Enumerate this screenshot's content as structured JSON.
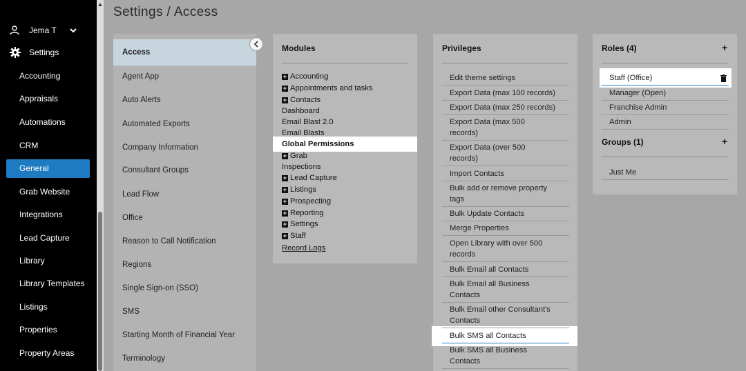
{
  "user": {
    "name": "Jema T"
  },
  "nav": {
    "settings_label": "Settings",
    "items": [
      {
        "label": "Accounting"
      },
      {
        "label": "Appraisals"
      },
      {
        "label": "Automations"
      },
      {
        "label": "CRM"
      },
      {
        "label": "General",
        "active": true
      },
      {
        "label": "Grab Website"
      },
      {
        "label": "Integrations"
      },
      {
        "label": "Lead Capture"
      },
      {
        "label": "Library"
      },
      {
        "label": "Library Templates"
      },
      {
        "label": "Listings"
      },
      {
        "label": "Properties"
      },
      {
        "label": "Property Areas"
      }
    ]
  },
  "page": {
    "title": "Settings / Access"
  },
  "settings_menu": {
    "items": [
      "Access",
      "Agent App",
      "Auto Alerts",
      "Automated Exports",
      "Company Information",
      "Consultant Groups",
      "Lead Flow",
      "Office",
      "Reason to Call Notification",
      "Regions",
      "Single Sign-on (SSO)",
      "SMS",
      "Starting Month of Financial Year",
      "Terminology"
    ]
  },
  "modules": {
    "title": "Modules",
    "items": [
      {
        "label": "Accounting",
        "expandable": true
      },
      {
        "label": "Appointments and tasks",
        "expandable": true
      },
      {
        "label": "Contacts",
        "expandable": true
      },
      {
        "label": "Dashboard",
        "expandable": false
      },
      {
        "label": "Email Blast 2.0",
        "expandable": false
      },
      {
        "label": "Email Blasts",
        "expandable": false
      },
      {
        "label": "Global Permissions",
        "expandable": false,
        "selected": true
      },
      {
        "label": "Grab",
        "expandable": true
      },
      {
        "label": "Inspections",
        "expandable": false
      },
      {
        "label": "Lead Capture",
        "expandable": true
      },
      {
        "label": "Listings",
        "expandable": true
      },
      {
        "label": "Prospecting",
        "expandable": true
      },
      {
        "label": "Reporting",
        "expandable": true
      },
      {
        "label": "Settings",
        "expandable": true
      },
      {
        "label": "Staff",
        "expandable": true
      },
      {
        "label": "Record Logs",
        "link": true
      }
    ]
  },
  "privileges": {
    "title": "Privileges",
    "items": [
      {
        "line1": "Edit theme settings"
      },
      {
        "line1": "Export Data (max 100 records)"
      },
      {
        "line1": "Export Data (max 250 records)"
      },
      {
        "line1": "Export Data (max 500",
        "line2": "records)"
      },
      {
        "line1": "Export Data (over 500",
        "line2": "records)"
      },
      {
        "line1": "Import Contacts"
      },
      {
        "line1": "Bulk add or remove property",
        "line2": "tags"
      },
      {
        "line1": "Bulk Update Contacts"
      },
      {
        "line1": "Merge Properties"
      },
      {
        "line1": "Open Library with over 500",
        "line2": "records"
      },
      {
        "line1": "Bulk Email all Contacts"
      },
      {
        "line1": "Bulk Email all Business",
        "line2": "Contacts"
      },
      {
        "line1": "Bulk Email other Consultant's",
        "line2": "Contacts"
      },
      {
        "line1": "Bulk SMS all Contacts",
        "selected": true
      },
      {
        "line1": "Bulk SMS all Business",
        "line2": "Contacts"
      }
    ]
  },
  "roles": {
    "title": "Roles (4)",
    "add_label": "+",
    "items": [
      "Staff (Office)",
      "Manager (Open)",
      "Franchise Admin",
      "Admin"
    ],
    "groups_title": "Groups (1)",
    "groups_add_label": "+",
    "groups": [
      "Just Me"
    ]
  }
}
